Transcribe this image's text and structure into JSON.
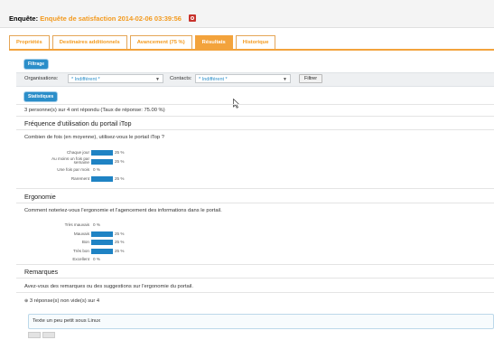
{
  "header": {
    "prefix": "Enquête:",
    "object_name": "Enquête de satisfaction 2014-02-06 03:39:56"
  },
  "tabs": [
    {
      "label": "Propriétés",
      "active": false
    },
    {
      "label": "Destinaires additionnels",
      "active": false
    },
    {
      "label": "Avancement (75 %)",
      "active": false
    },
    {
      "label": "Résultats",
      "active": true
    },
    {
      "label": "Historique",
      "active": false
    }
  ],
  "filter": {
    "section_label": "Filtrage",
    "org_label": "Organisations:",
    "org_value": "* Indifférent *",
    "contact_label": "Contacts:",
    "contact_value": "* Indifférent *",
    "button_label": "Filtrer"
  },
  "stats": {
    "section_label": "Statistiques",
    "summary": "3 personne(s) sur 4 ont répondu (Taux de réponse: 75.00 %)"
  },
  "questions": [
    {
      "title": "Fréquence d'utilisation du portail iTop",
      "question": "Combien de fois (en moyenne), utilisez-vous le portail iTop ?"
    },
    {
      "title": "Ergonomie",
      "question": "Comment noteriez-vous l'ergonomie et l'agencement des informations dans le portail."
    },
    {
      "title": "Remarques",
      "question": "Avez-vous des remarques ou des suggestions sur l'ergonomie du portail.",
      "answers_toggle": "3 réponse(s) non vide(s) sur 4",
      "answer_text": "Texte un peu petit sous Linux"
    }
  ],
  "chart_data": [
    {
      "type": "bar",
      "orientation": "horizontal",
      "categories": [
        "Chaque jour",
        "Au moins un fois par semaine",
        "Une fois par mois",
        "Rarement"
      ],
      "values": [
        25,
        25,
        0,
        25
      ],
      "value_labels": [
        "25 %",
        "25 %",
        "0 %",
        "25 %"
      ],
      "unit": "%"
    },
    {
      "type": "bar",
      "orientation": "horizontal",
      "categories": [
        "Très mauvais",
        "Mauvais",
        "Bon",
        "Très bon",
        "Excellent"
      ],
      "values": [
        0,
        25,
        25,
        25,
        0
      ],
      "value_labels": [
        "0 %",
        "25 %",
        "25 %",
        "25 %",
        "0 %"
      ],
      "unit": "%"
    }
  ],
  "colors": {
    "accent_orange": "#f3a33c",
    "bar_blue": "#1f83c4",
    "button_blue": "#2b8ec9",
    "close_red": "#c8332d"
  }
}
